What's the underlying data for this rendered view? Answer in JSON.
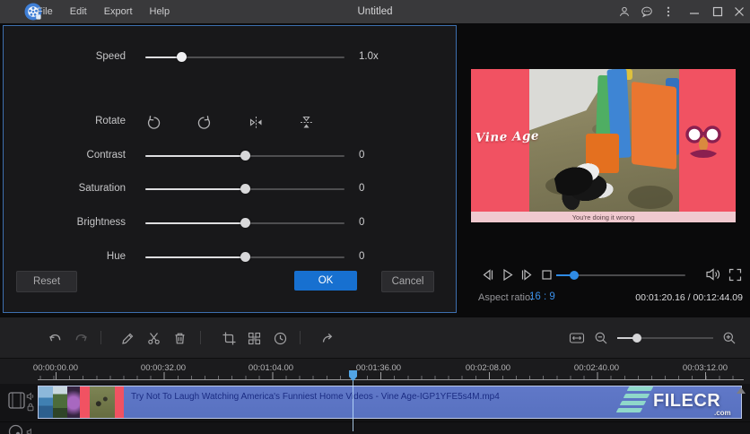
{
  "titlebar": {
    "menus": [
      "File",
      "Edit",
      "Export",
      "Help"
    ],
    "title": "Untitled",
    "right_icons": [
      "account",
      "feedback",
      "more",
      "minimize",
      "maximize",
      "close"
    ]
  },
  "edit_panel": {
    "sliders": [
      {
        "label": "Speed",
        "value": "1.0x"
      },
      {
        "label": "Contrast",
        "value": "0"
      },
      {
        "label": "Saturation",
        "value": "0"
      },
      {
        "label": "Brightness",
        "value": "0"
      },
      {
        "label": "Hue",
        "value": "0"
      }
    ],
    "rotate_label": "Rotate",
    "rotate_buttons": [
      "rotate-left",
      "rotate-right",
      "flip-horizontal",
      "flip-vertical"
    ],
    "buttons": {
      "reset": "Reset",
      "ok": "OK",
      "cancel": "Cancel"
    }
  },
  "preview": {
    "video_overlay_text": "Vine Age",
    "video_caption": "You're doing it wrong",
    "controls": [
      "previous-frame",
      "play",
      "next-frame",
      "stop",
      "volume",
      "fullscreen"
    ],
    "aspect_ratio_label": "Aspect ratio:",
    "aspect_ratio_value": "16 : 9",
    "timecode": "00:01:20.16 / 00:12:44.09"
  },
  "toolbar": {
    "buttons": [
      "undo",
      "redo",
      "edit",
      "split",
      "delete",
      "crop",
      "mosaic",
      "duration",
      "export"
    ],
    "zoom_controls": [
      "fit-to-timeline",
      "zoom-out",
      "zoom-slider",
      "zoom-in"
    ]
  },
  "timeline": {
    "ruler_labels": [
      "00:00:00.00",
      "00:00:32.00",
      "00:01:04.00",
      "00:01:36.00",
      "00:02:08.00",
      "00:02:40.00",
      "00:03:12.00"
    ],
    "clip_name": "Try Not To Laugh Watching America's Funniest Home Videos - Vine Age-IGP1YFE5s4M.mp4",
    "tracks": [
      "video-track",
      "pip-track"
    ]
  },
  "watermark": {
    "name": "FILECR",
    "domain": ".com"
  },
  "colors": {
    "accent_blue": "#1770d0",
    "progress_blue": "#2f8be4",
    "clip_blue": "#5a74c4",
    "video_pink": "#f15262",
    "playhead_blue": "#52a5e6",
    "watermark_teal": "#8fd8ca"
  }
}
